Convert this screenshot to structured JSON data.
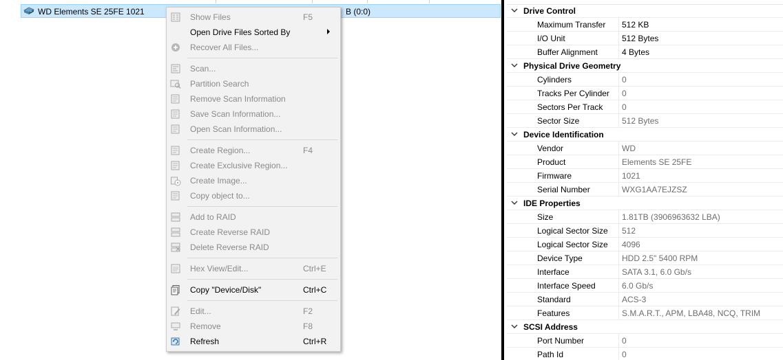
{
  "tree": {
    "drive_row": {
      "label": "WD Elements SE 25FE 1021",
      "size_fragment": "B (0:0)"
    }
  },
  "properties": {
    "rows": [
      {
        "type": "header",
        "name": "Drive Control"
      },
      {
        "type": "prop",
        "name": "Maximum Transfer",
        "value": "512 KB",
        "dark": true
      },
      {
        "type": "prop",
        "name": "I/O Unit",
        "value": "512 Bytes",
        "dark": true
      },
      {
        "type": "prop",
        "name": "Buffer Alignment",
        "value": "4 Bytes",
        "dark": true
      },
      {
        "type": "header",
        "name": "Physical Drive Geometry"
      },
      {
        "type": "prop",
        "name": "Cylinders",
        "value": "0"
      },
      {
        "type": "prop",
        "name": "Tracks Per Cylinder",
        "value": "0"
      },
      {
        "type": "prop",
        "name": "Sectors Per Track",
        "value": "0"
      },
      {
        "type": "prop",
        "name": "Sector Size",
        "value": "512 Bytes"
      },
      {
        "type": "header",
        "name": "Device Identification"
      },
      {
        "type": "prop",
        "name": "Vendor",
        "value": "WD"
      },
      {
        "type": "prop",
        "name": "Product",
        "value": "Elements SE 25FE"
      },
      {
        "type": "prop",
        "name": "Firmware",
        "value": "1021"
      },
      {
        "type": "prop",
        "name": "Serial Number",
        "value": "WXG1AA7EJZSZ"
      },
      {
        "type": "header",
        "name": "IDE Properties"
      },
      {
        "type": "prop",
        "name": "Size",
        "value": "1.81TB (3906963632 LBA)"
      },
      {
        "type": "prop",
        "name": "Logical Sector Size",
        "value": "512"
      },
      {
        "type": "prop",
        "name": "Logical Sector Size",
        "value": "4096"
      },
      {
        "type": "prop",
        "name": "Device Type",
        "value": "HDD 2.5\" 5400 RPM"
      },
      {
        "type": "prop",
        "name": "Interface",
        "value": "SATA 3.1, 6.0 Gb/s"
      },
      {
        "type": "prop",
        "name": "Interface Speed",
        "value": "6.0 Gb/s"
      },
      {
        "type": "prop",
        "name": "Standard",
        "value": "ACS-3"
      },
      {
        "type": "prop",
        "name": "Features",
        "value": "S.M.A.R.T., APM, LBA48, NCQ, TRIM"
      },
      {
        "type": "header",
        "name": "SCSI Address"
      },
      {
        "type": "prop",
        "name": "Port Number",
        "value": "0"
      },
      {
        "type": "prop",
        "name": "Path Id",
        "value": "0"
      }
    ]
  },
  "context_menu": {
    "items": [
      {
        "label": "Show Files",
        "shortcut": "F5",
        "enabled": false,
        "icon": "show-files-icon"
      },
      {
        "label": "Open Drive Files Sorted By",
        "shortcut": "",
        "enabled": true,
        "submenu": true,
        "icon": ""
      },
      {
        "label": "Recover All Files...",
        "shortcut": "",
        "enabled": false,
        "icon": "recover-icon"
      },
      {
        "separator": true
      },
      {
        "label": "Scan...",
        "shortcut": "",
        "enabled": false,
        "icon": "scan-icon"
      },
      {
        "label": "Partition Search",
        "shortcut": "",
        "enabled": false,
        "icon": "partition-search-icon"
      },
      {
        "label": "Remove Scan Information",
        "shortcut": "",
        "enabled": false,
        "icon": "remove-scan-icon"
      },
      {
        "label": "Save Scan Information...",
        "shortcut": "",
        "enabled": false,
        "icon": "save-scan-icon"
      },
      {
        "label": "Open Scan Information...",
        "shortcut": "",
        "enabled": false,
        "icon": "open-scan-icon"
      },
      {
        "separator": true
      },
      {
        "label": "Create Region...",
        "shortcut": "F4",
        "enabled": false,
        "icon": "create-region-icon"
      },
      {
        "label": "Create Exclusive Region...",
        "shortcut": "",
        "enabled": false,
        "icon": "create-exclusive-region-icon"
      },
      {
        "label": "Create Image...",
        "shortcut": "",
        "enabled": false,
        "icon": "create-image-icon"
      },
      {
        "label": "Copy object to...",
        "shortcut": "",
        "enabled": false,
        "icon": "copy-object-icon"
      },
      {
        "separator": true
      },
      {
        "label": "Add to RAID",
        "shortcut": "",
        "enabled": false,
        "icon": "add-raid-icon"
      },
      {
        "label": "Create Reverse RAID",
        "shortcut": "",
        "enabled": false,
        "icon": "create-reverse-raid-icon"
      },
      {
        "label": "Delete Reverse RAID",
        "shortcut": "",
        "enabled": false,
        "icon": "delete-reverse-raid-icon"
      },
      {
        "separator": true
      },
      {
        "label": "Hex View/Edit...",
        "shortcut": "Ctrl+E",
        "enabled": false,
        "icon": "hex-view-icon"
      },
      {
        "separator": true
      },
      {
        "label": "Copy \"Device/Disk\"",
        "shortcut": "Ctrl+C",
        "enabled": true,
        "icon": "copy-icon"
      },
      {
        "separator": true
      },
      {
        "label": "Edit...",
        "shortcut": "F2",
        "enabled": false,
        "icon": "edit-icon"
      },
      {
        "label": "Remove",
        "shortcut": "F8",
        "enabled": false,
        "icon": "remove-icon"
      },
      {
        "label": "Refresh",
        "shortcut": "Ctrl+R",
        "enabled": true,
        "icon": "refresh-icon"
      }
    ]
  }
}
